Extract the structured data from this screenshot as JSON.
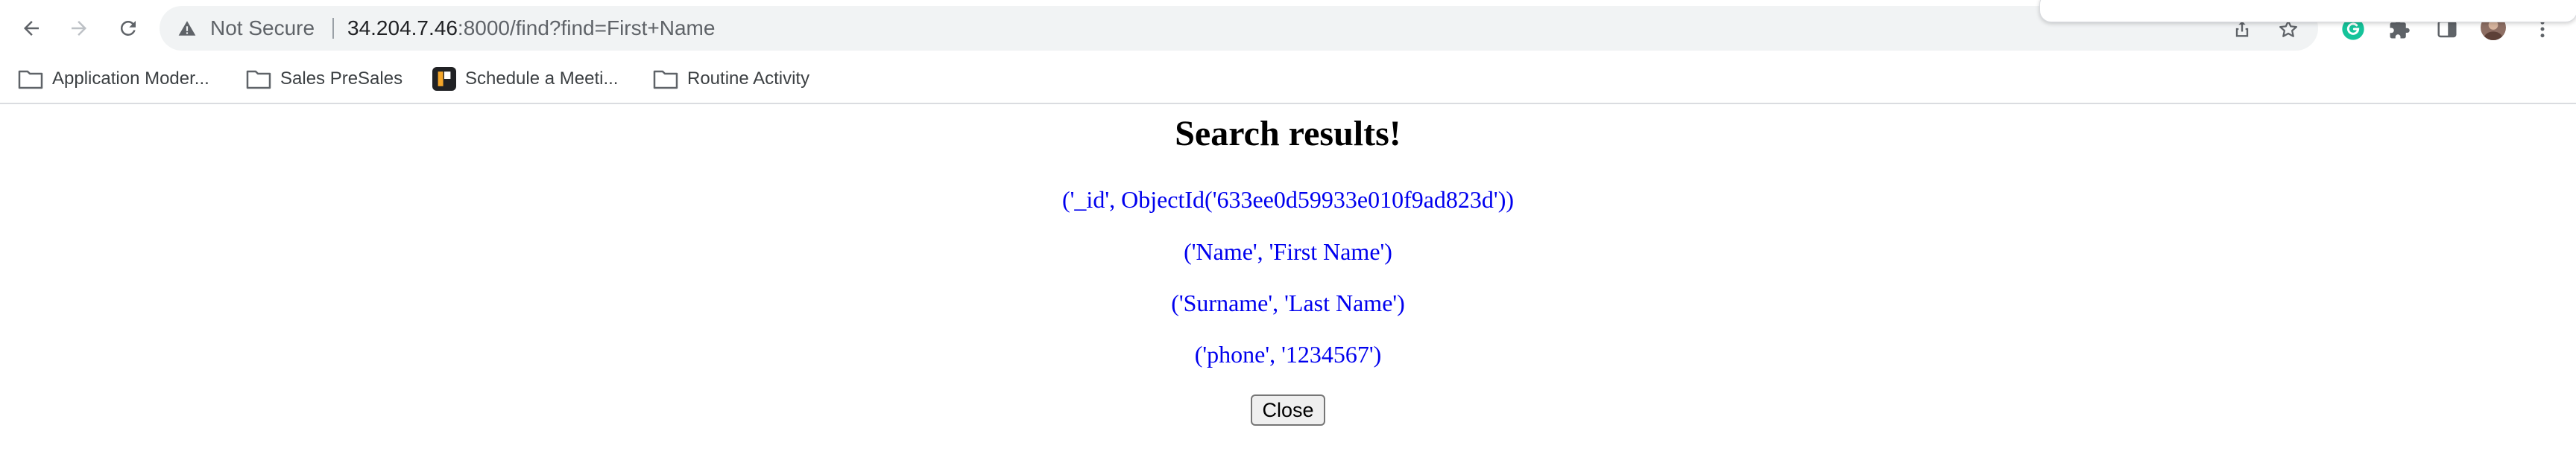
{
  "browser": {
    "omnibox": {
      "security_label": "Not Secure",
      "url_host": "34.204.7.46",
      "url_rest": ":8000/find?find=First+Name"
    },
    "bookmarks": [
      {
        "label": "Application Moder...",
        "icon": "folder-icon"
      },
      {
        "label": "Sales PreSales",
        "icon": "folder-icon"
      },
      {
        "label": "Schedule a Meeti...",
        "icon": "site-favicon"
      },
      {
        "label": "Routine Activity",
        "icon": "folder-icon"
      }
    ]
  },
  "page": {
    "heading": "Search results!",
    "results": [
      "('_id', ObjectId('633ee0d59933e010f9ad823d'))",
      "('Name', 'First Name')",
      "('Surname', 'Last Name')",
      "('phone', '1234567')"
    ],
    "close_label": "Close"
  },
  "colors": {
    "result_text": "#0000ee",
    "omnibox_bg": "#f1f3f4",
    "grammarly_green": "#15c39a"
  }
}
